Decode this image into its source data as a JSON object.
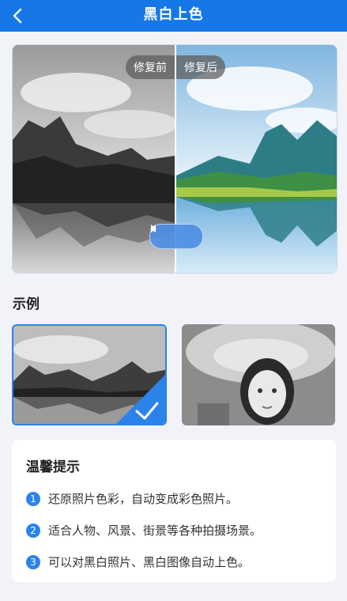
{
  "header": {
    "title": "黑白上色",
    "back_icon": "chevron-left-icon"
  },
  "compare": {
    "before_label": "修复前",
    "after_label": "修复后"
  },
  "section": {
    "examples_title": "示例"
  },
  "tips": {
    "title": "温馨提示",
    "items": [
      {
        "num": "1",
        "text": "还原照片色彩，自动变成彩色照片。"
      },
      {
        "num": "2",
        "text": "适合人物、风景、街景等各种拍摄场景。"
      },
      {
        "num": "3",
        "text": "可以对黑白照片、黑白图像自动上色。"
      }
    ]
  },
  "colors": {
    "accent": "#1677e6",
    "badge": "#2b83ea",
    "background": "#f1f3f8"
  }
}
